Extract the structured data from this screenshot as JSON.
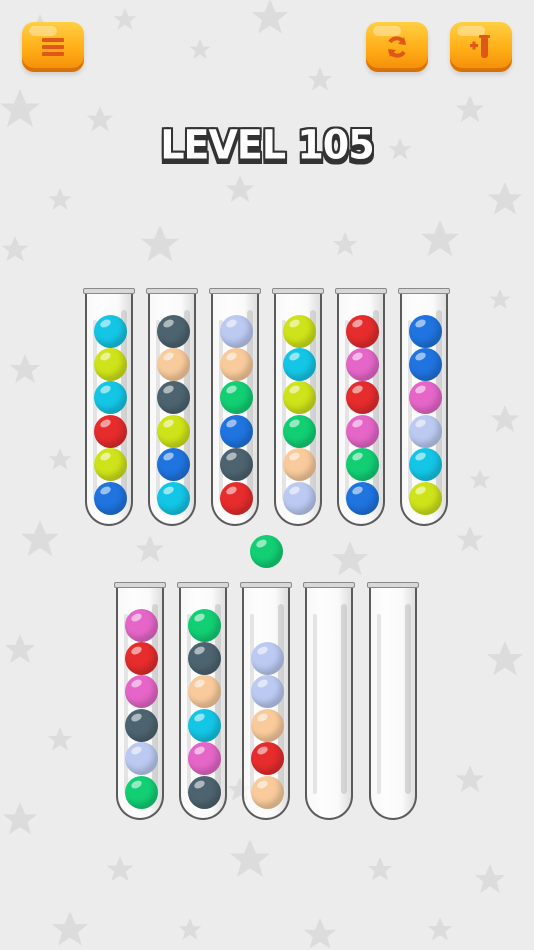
{
  "header": {
    "level_label": "LEVEL 105",
    "menu_icon": "menu-icon",
    "restart_icon": "restart-icon",
    "add_tube_icon": "add-tube-icon",
    "button_color": "#ffb21a"
  },
  "palette": {
    "cyan": "#14c6e6",
    "yellow": "#cfe31a",
    "red": "#e62c2c",
    "blue": "#1f74e0",
    "slate": "#4d6470",
    "peach": "#f9cb9c",
    "lavender": "#bccaf2",
    "green": "#12cf74",
    "pink": "#e566c8"
  },
  "lifted_ball": "green",
  "top_row_tubes": [
    [
      "blue",
      "yellow",
      "red",
      "cyan",
      "yellow",
      "cyan"
    ],
    [
      "cyan",
      "blue",
      "yellow",
      "slate",
      "peach",
      "slate"
    ],
    [
      "red",
      "slate",
      "blue",
      "green",
      "peach",
      "lavender"
    ],
    [
      "lavender",
      "peach",
      "green",
      "yellow",
      "cyan",
      "yellow"
    ],
    [
      "blue",
      "green",
      "pink",
      "red",
      "pink",
      "red"
    ],
    [
      "yellow",
      "cyan",
      "lavender",
      "pink",
      "blue",
      "blue"
    ]
  ],
  "bottom_row_tubes": [
    [
      "green",
      "lavender",
      "slate",
      "pink",
      "red",
      "pink"
    ],
    [
      "slate",
      "pink",
      "cyan",
      "peach",
      "slate",
      "green"
    ],
    [
      "peach",
      "red",
      "peach",
      "lavender",
      "lavender"
    ],
    [],
    []
  ]
}
